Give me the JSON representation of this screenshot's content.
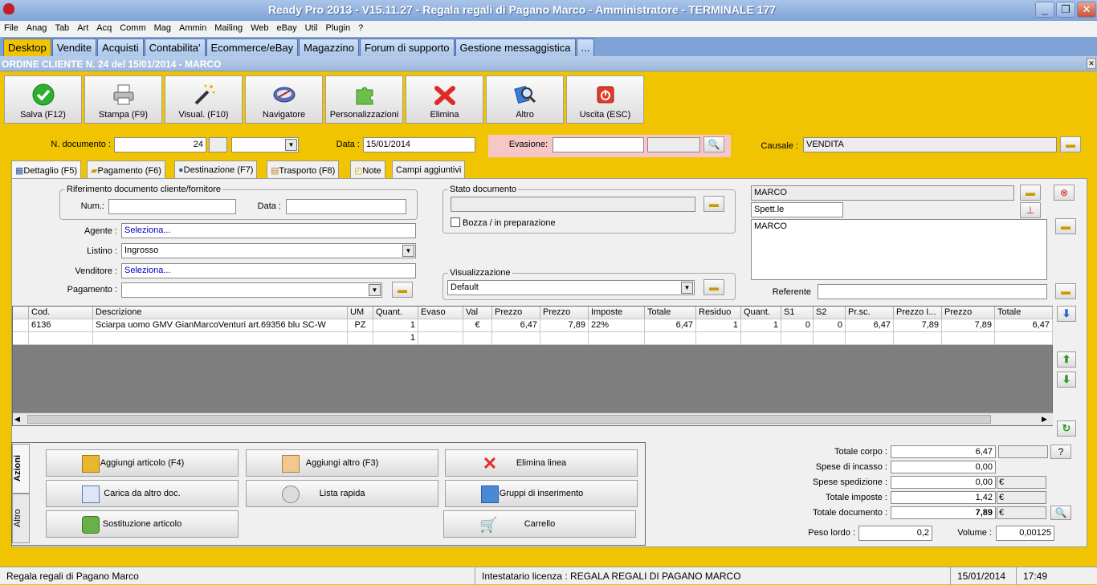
{
  "window": {
    "title": "Ready Pro 2013 - V15.11.27 - Regala regali di Pagano Marco - Amministratore - TERMINALE 177",
    "minimize": "_",
    "maximize": "❐",
    "close": "✕"
  },
  "menu": [
    "File",
    "Anag",
    "Tab",
    "Art",
    "Acq",
    "Comm",
    "Mag",
    "Ammin",
    "Mailing",
    "Web",
    "eBay",
    "Util",
    "Plugin",
    "?"
  ],
  "tabs": [
    "Desktop",
    "Vendite",
    "Acquisti",
    "Contabilita'",
    "Ecommerce/eBay",
    "Magazzino",
    "Forum di supporto",
    "Gestione messaggistica",
    "..."
  ],
  "order_title": "ORDINE CLIENTE N. 24 del 15/01/2014 - MARCO",
  "toolbar": {
    "save": "Salva (F12)",
    "print": "Stampa (F9)",
    "visual": "Visual. (F10)",
    "navigator": "Navigatore",
    "custom": "Personalizzazioni",
    "delete": "Elimina",
    "other": "Altro",
    "exit": "Uscita (ESC)"
  },
  "header": {
    "ndoc_label": "N. documento :",
    "ndoc_value": "24",
    "data_label": "Data :",
    "data_value": "15/01/2014",
    "evasione_label": "Evasione:",
    "evasione_value": "",
    "causale_label": "Causale :",
    "causale_value": "VENDITA"
  },
  "subtabs": [
    "Dettaglio (F5)",
    "Pagamento (F6)",
    "Destinazione (F7)",
    "Trasporto (F8)",
    "Note",
    "Campi aggiuntivi"
  ],
  "riferimento": {
    "title": "Riferimento documento cliente/fornitore",
    "num_label": "Num.:",
    "num_value": "",
    "data_label": "Data :",
    "data_value": ""
  },
  "agente": {
    "label": "Agente :",
    "value": "Seleziona..."
  },
  "listino": {
    "label": "Listino :",
    "value": "Ingrosso"
  },
  "venditore": {
    "label": "Venditore :",
    "value": "Seleziona..."
  },
  "pagamento": {
    "label": "Pagamento :",
    "value": ""
  },
  "stato": {
    "title": "Stato documento",
    "value": "",
    "bozza": "Bozza / in preparazione"
  },
  "visualizzazione": {
    "title": "Visualizzazione",
    "value": "Default"
  },
  "cliente": {
    "name": "MARCO",
    "prefix": "Spett.le",
    "address": "MARCO",
    "referente_label": "Referente",
    "referente_value": ""
  },
  "grid": {
    "headers": [
      "",
      "Cod.",
      "Descrizione",
      "UM",
      "Quant.",
      "Evaso",
      "Val",
      "Prezzo",
      "Prezzo",
      "Imposte",
      "Totale",
      "Residuo",
      "Quant.",
      "S1",
      "S2",
      "Pr.sc.",
      "Prezzo I...",
      "Prezzo",
      "Totale"
    ],
    "rows": [
      [
        "",
        "6136",
        "Sciarpa uomo GMV GianMarcoVenturi art.69356 blu SC-W",
        "PZ",
        "1",
        "",
        "€",
        "6,47",
        "7,89",
        "22%",
        "6,47",
        "1",
        "1",
        "0",
        "0",
        "6,47",
        "7,89",
        "7,89",
        "6,47"
      ],
      [
        "",
        "",
        "",
        "",
        "1",
        "",
        "",
        "",
        "",
        "",
        "",
        "",
        "",
        "",
        "",
        "",
        "",
        "",
        ""
      ]
    ]
  },
  "actions": {
    "vtab_azioni": "Azioni",
    "vtab_altro": "Altro",
    "add_item": "Aggiungi articolo (F4)",
    "add_other": "Aggiungi altro (F3)",
    "delete_line": "Elimina linea",
    "load_doc": "Carica da altro doc.",
    "quick_list": "Lista rapida",
    "insert_groups": "Gruppi di inserimento",
    "replace_item": "Sostituzione articolo",
    "cart": "Carrello"
  },
  "totals": {
    "corpo_label": "Totale corpo :",
    "corpo_value": "6,47",
    "help": "?",
    "incasso_label": "Spese di incasso :",
    "incasso_value": "0,00",
    "spedizione_label": "Spese spedizione :",
    "spedizione_value": "0,00",
    "imposte_label": "Totale imposte :",
    "imposte_value": "1,42",
    "documento_label": "Totale documento :",
    "documento_value": "7,89",
    "currency": "€",
    "peso_label": "Peso lordo :",
    "peso_value": "0,2",
    "volume_label": "Volume :",
    "volume_value": "0,00125"
  },
  "status": {
    "company": "Regala regali di Pagano Marco",
    "license": "Intestatario licenza : REGALA REGALI DI PAGANO MARCO",
    "date": "15/01/2014",
    "time": "17:49"
  }
}
